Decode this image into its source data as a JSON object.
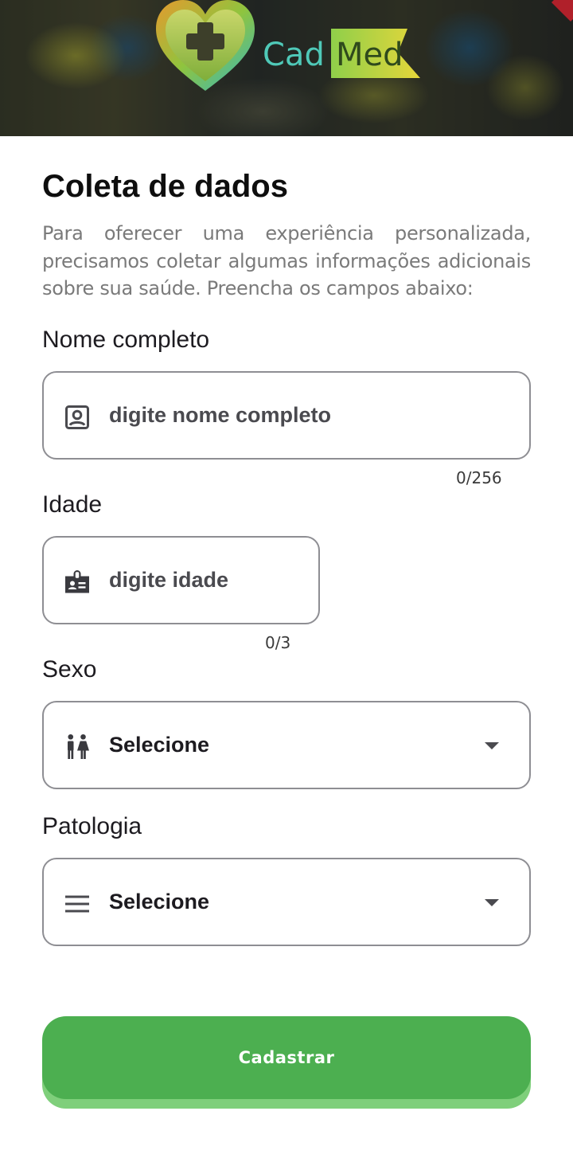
{
  "header": {
    "logo_cad": "Cad",
    "logo_med": "Med"
  },
  "form": {
    "title": "Coleta de dados",
    "intro": "Para oferecer uma experiência personalizada, precisamos coletar algumas informações adicionais sobre sua saúde. Preencha os campos abaixo:",
    "name": {
      "label": "Nome completo",
      "placeholder": "digite nome completo",
      "counter": "0/256",
      "icon": "account-box-icon"
    },
    "age": {
      "label": "Idade",
      "placeholder": "digite idade",
      "counter": "0/3",
      "icon": "badge-icon"
    },
    "sex": {
      "label": "Sexo",
      "value": "Selecione",
      "icon": "wc-icon"
    },
    "pathology": {
      "label": "Patologia",
      "value": "Selecione",
      "icon": "menu-icon"
    },
    "submit_label": "Cadastrar"
  },
  "colors": {
    "accent": "#4caf50",
    "border": "#8e8e93"
  }
}
